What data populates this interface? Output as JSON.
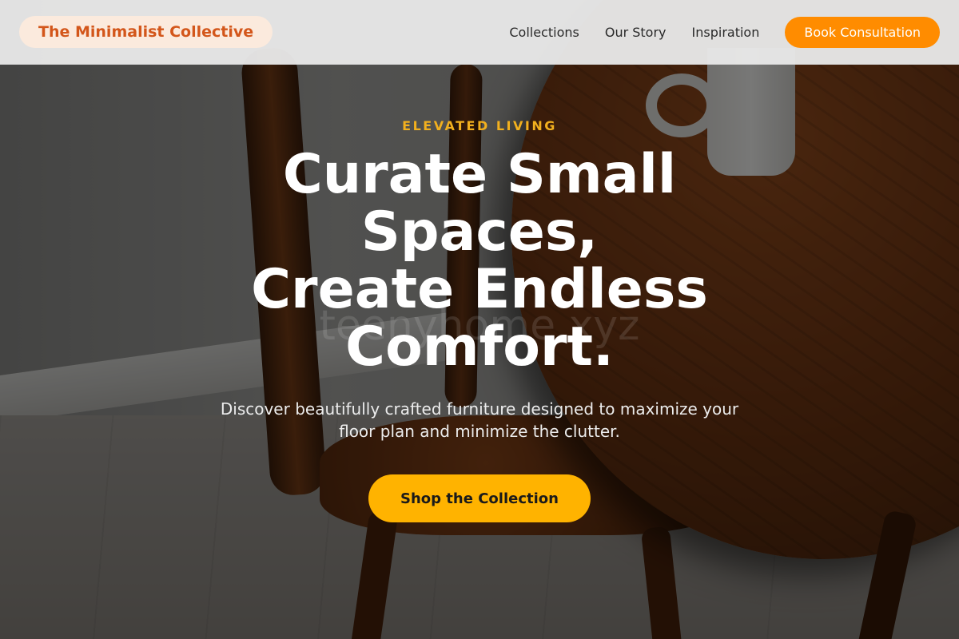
{
  "header": {
    "brand": "The Minimalist Collective",
    "nav": [
      {
        "label": "Collections"
      },
      {
        "label": "Our Story"
      },
      {
        "label": "Inspiration"
      }
    ],
    "cta": "Book Consultation"
  },
  "hero": {
    "eyebrow": "ELEVATED LIVING",
    "headline_lines": [
      "Curate Small",
      "Spaces,",
      "Create Endless",
      "Comfort."
    ],
    "watermark": "teenyhome.xyz",
    "subcopy": "Discover beautifully crafted furniture designed to maximize your floor plan and minimize the clutter.",
    "cta": "Shop the Collection"
  },
  "colors": {
    "brand_text": "#d3561a",
    "brand_pill": "#fbeadd",
    "header_cta": "#ff8c00",
    "eyebrow": "#f2b01e",
    "hero_cta": "#ffb300"
  }
}
